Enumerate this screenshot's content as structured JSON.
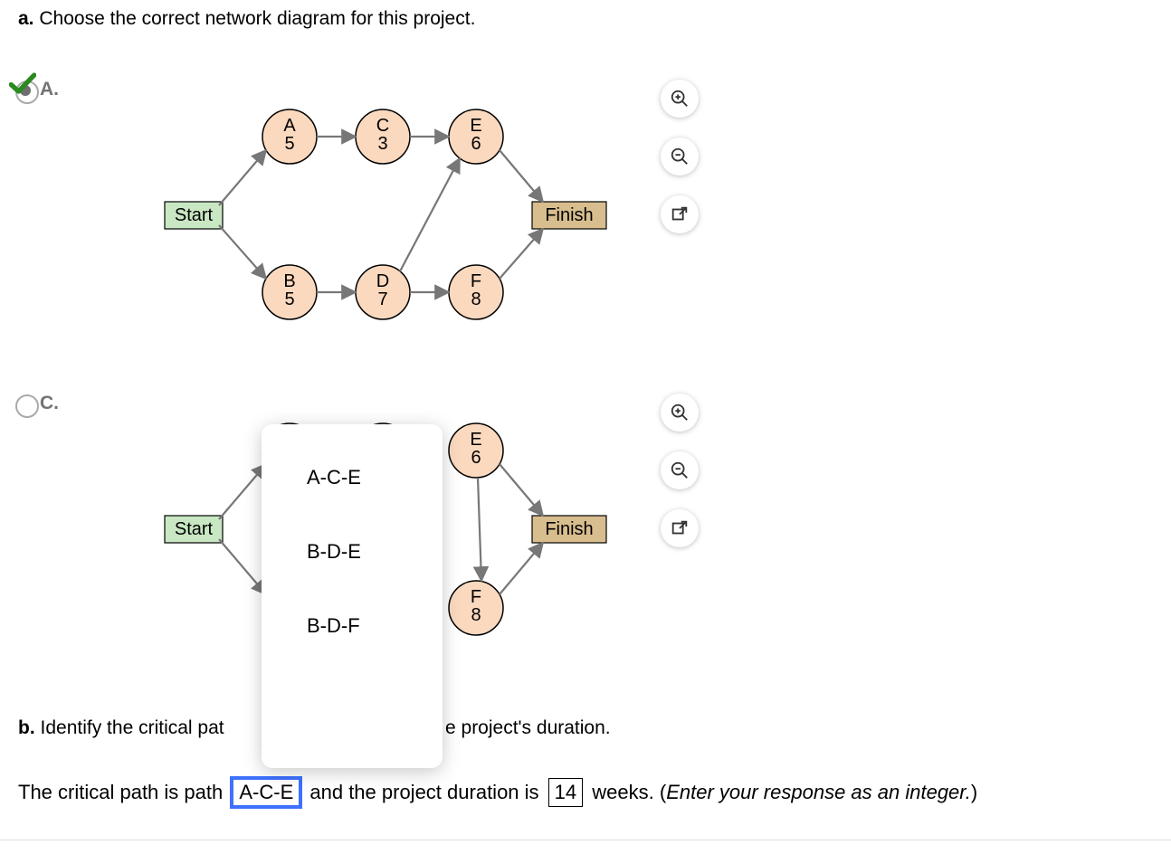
{
  "question_a": {
    "label": "a.",
    "text": "Choose the correct network diagram for this project."
  },
  "options": {
    "A": {
      "label": "A.",
      "selected": true
    },
    "C": {
      "label": "C.",
      "selected": false
    }
  },
  "diagram": {
    "start": "Start",
    "finish": "Finish",
    "nodes": {
      "A": {
        "name": "A",
        "dur": "5"
      },
      "B": {
        "name": "B",
        "dur": "5"
      },
      "C": {
        "name": "C",
        "dur": "3"
      },
      "D": {
        "name": "D",
        "dur": "7"
      },
      "E": {
        "name": "E",
        "dur": "6"
      },
      "F": {
        "name": "F",
        "dur": "8"
      }
    }
  },
  "dropdown": {
    "items": [
      "A-C-E",
      "B-D-E",
      "B-D-F"
    ]
  },
  "question_b": {
    "label": "b.",
    "prefix": "Identify the critical pat",
    "suffix": "e project's duration."
  },
  "answer": {
    "t1": "The critical path is path",
    "path": "A-C-E",
    "t2": "and the project duration is",
    "duration": "14",
    "t3": "weeks. (",
    "hint": "Enter your response as an integer.",
    "t4": ")"
  }
}
